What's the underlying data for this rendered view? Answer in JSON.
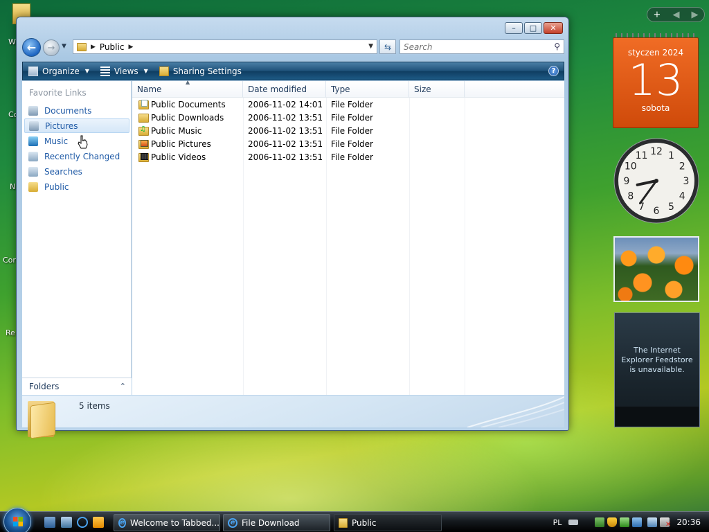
{
  "window": {
    "address": {
      "crumb": "Public"
    },
    "search": {
      "placeholder": "Search"
    },
    "toolbar": {
      "organize": "Organize",
      "views": "Views",
      "sharing": "Sharing Settings"
    },
    "nav": {
      "title": "Favorite Links",
      "items": [
        {
          "label": "Documents",
          "icon": "documents-icon"
        },
        {
          "label": "Pictures",
          "icon": "pictures-icon"
        },
        {
          "label": "Music",
          "icon": "music-icon"
        },
        {
          "label": "Recently Changed",
          "icon": "recently-changed-icon"
        },
        {
          "label": "Searches",
          "icon": "searches-icon"
        },
        {
          "label": "Public",
          "icon": "folder-icon"
        }
      ],
      "folders": "Folders"
    },
    "columns": {
      "name": "Name",
      "date": "Date modified",
      "type": "Type",
      "size": "Size"
    },
    "files": [
      {
        "name": "Public Documents",
        "date": "2006-11-02 14:01",
        "type": "File Folder"
      },
      {
        "name": "Public Downloads",
        "date": "2006-11-02 13:51",
        "type": "File Folder"
      },
      {
        "name": "Public Music",
        "date": "2006-11-02 13:51",
        "type": "File Folder"
      },
      {
        "name": "Public Pictures",
        "date": "2006-11-02 13:51",
        "type": "File Folder"
      },
      {
        "name": "Public Videos",
        "date": "2006-11-02 13:51",
        "type": "File Folder"
      }
    ],
    "status": "5 items"
  },
  "gadgets": {
    "calendar": {
      "month": "styczen 2024",
      "day": "13",
      "weekday": "sobota"
    },
    "clock": {
      "hour": 8,
      "minute": 36
    },
    "feed": {
      "message": "The Internet Explorer Feedstore is unavailable."
    }
  },
  "taskbar": {
    "buttons": [
      {
        "label": "Welcome to Tabbed..."
      },
      {
        "label": "File Download"
      },
      {
        "label": "Public"
      }
    ],
    "lang": "PL",
    "time": "20:36"
  }
}
